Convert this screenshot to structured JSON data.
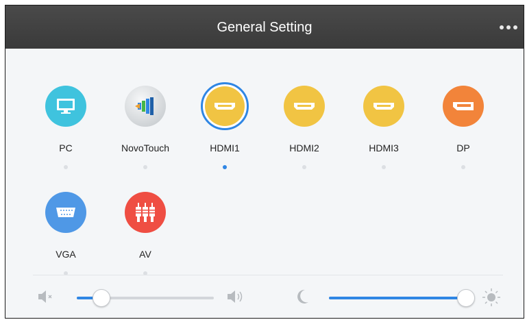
{
  "header": {
    "title": "General Setting",
    "more_icon": "more-dots-icon"
  },
  "sources": [
    {
      "label": "PC",
      "icon": "monitor-icon",
      "color": "#3fc3de",
      "selected": false
    },
    {
      "label": "NovoTouch",
      "icon": "novotouch-icon",
      "color": "#d9dde0",
      "selected": false
    },
    {
      "label": "HDMI1",
      "icon": "hdmi-icon",
      "color": "#f1c443",
      "selected": true
    },
    {
      "label": "HDMI2",
      "icon": "hdmi-icon",
      "color": "#f1c443",
      "selected": false
    },
    {
      "label": "HDMI3",
      "icon": "hdmi-icon",
      "color": "#f1c443",
      "selected": false
    },
    {
      "label": "DP",
      "icon": "displayport-icon",
      "color": "#f2843a",
      "selected": false
    },
    {
      "label": "VGA",
      "icon": "vga-icon",
      "color": "#4f98e6",
      "selected": false
    },
    {
      "label": "AV",
      "icon": "av-rca-icon",
      "color": "#ef4e43",
      "selected": false
    }
  ],
  "volume": {
    "mute_icon": "speaker-mute-icon",
    "max_icon": "speaker-loud-icon",
    "level_fraction": 0.18
  },
  "brightness": {
    "min_icon": "moon-icon",
    "max_icon": "sun-icon",
    "level_fraction": 1.0
  },
  "colors": {
    "accent": "#2f86e4",
    "titlebar": "#404040",
    "background": "#f4f6f8"
  }
}
